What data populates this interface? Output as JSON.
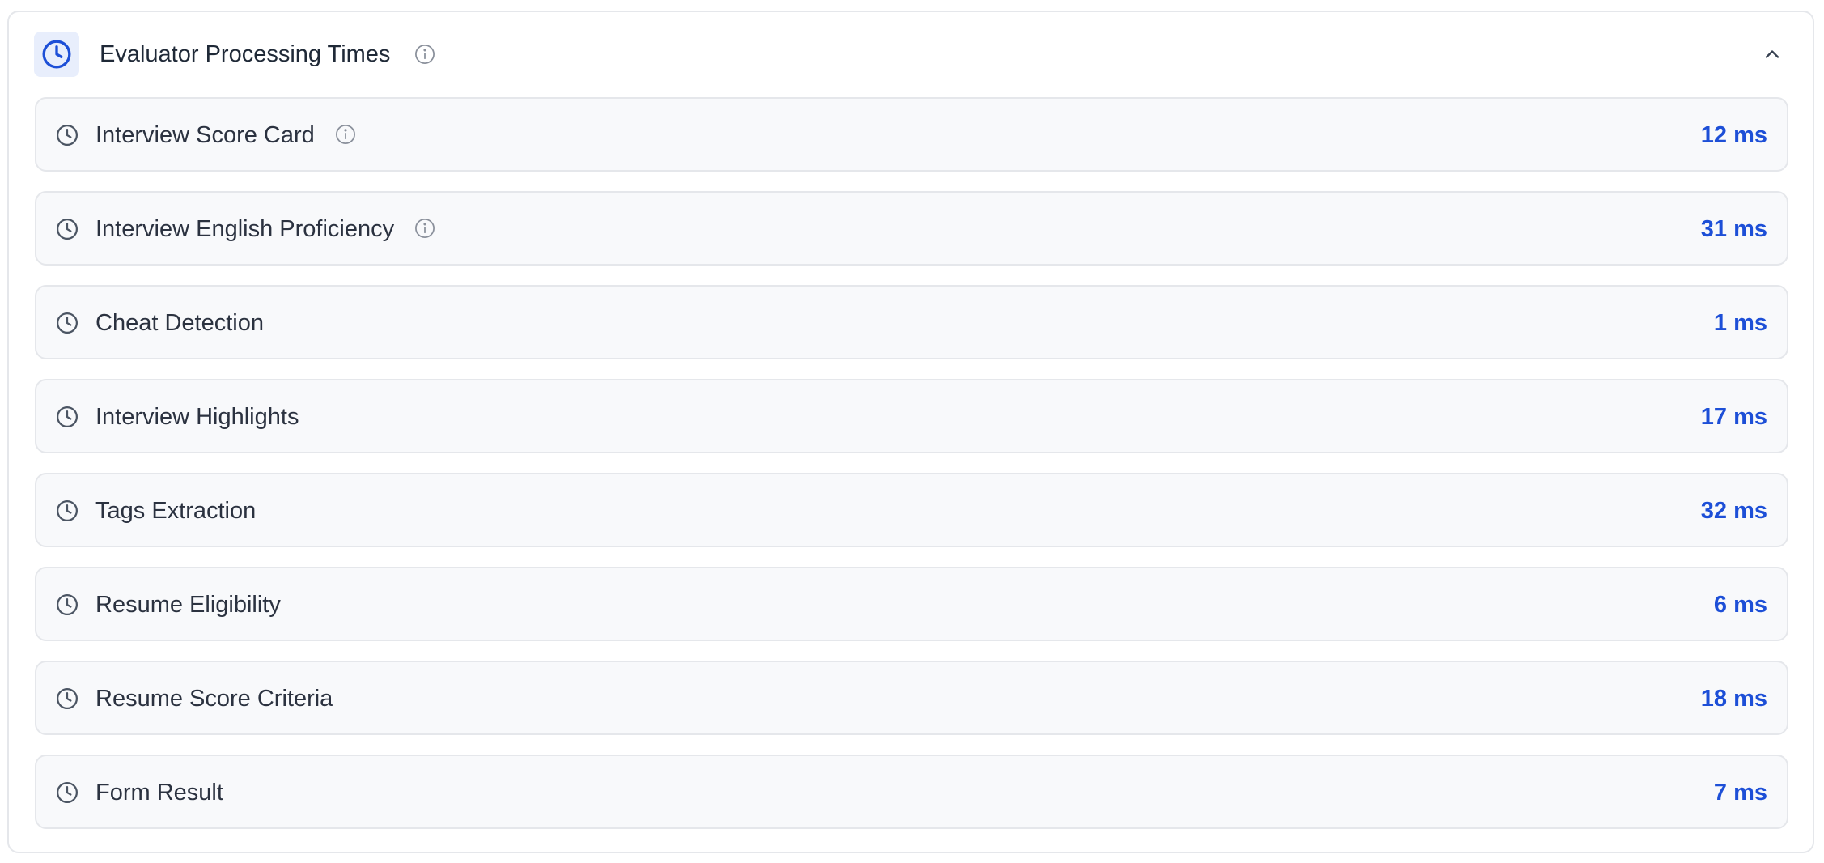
{
  "header": {
    "title": "Evaluator Processing Times",
    "icon": "clock-icon",
    "info_icon": "info-icon",
    "toggle_icon": "chevron-up-icon"
  },
  "colors": {
    "accent": "#1d4fd7",
    "icon_bg": "#e8eefc",
    "row_bg": "#f8f9fb",
    "border": "#e5e7eb"
  },
  "rows": [
    {
      "label": "Interview Score Card",
      "value": "12 ms",
      "has_info": true
    },
    {
      "label": "Interview English Proficiency",
      "value": "31 ms",
      "has_info": true
    },
    {
      "label": "Cheat Detection",
      "value": "1 ms",
      "has_info": false
    },
    {
      "label": "Interview Highlights",
      "value": "17 ms",
      "has_info": false
    },
    {
      "label": "Tags Extraction",
      "value": "32 ms",
      "has_info": false
    },
    {
      "label": "Resume Eligibility",
      "value": "6 ms",
      "has_info": false
    },
    {
      "label": "Resume Score Criteria",
      "value": "18 ms",
      "has_info": false
    },
    {
      "label": "Form Result",
      "value": "7 ms",
      "has_info": false
    }
  ]
}
